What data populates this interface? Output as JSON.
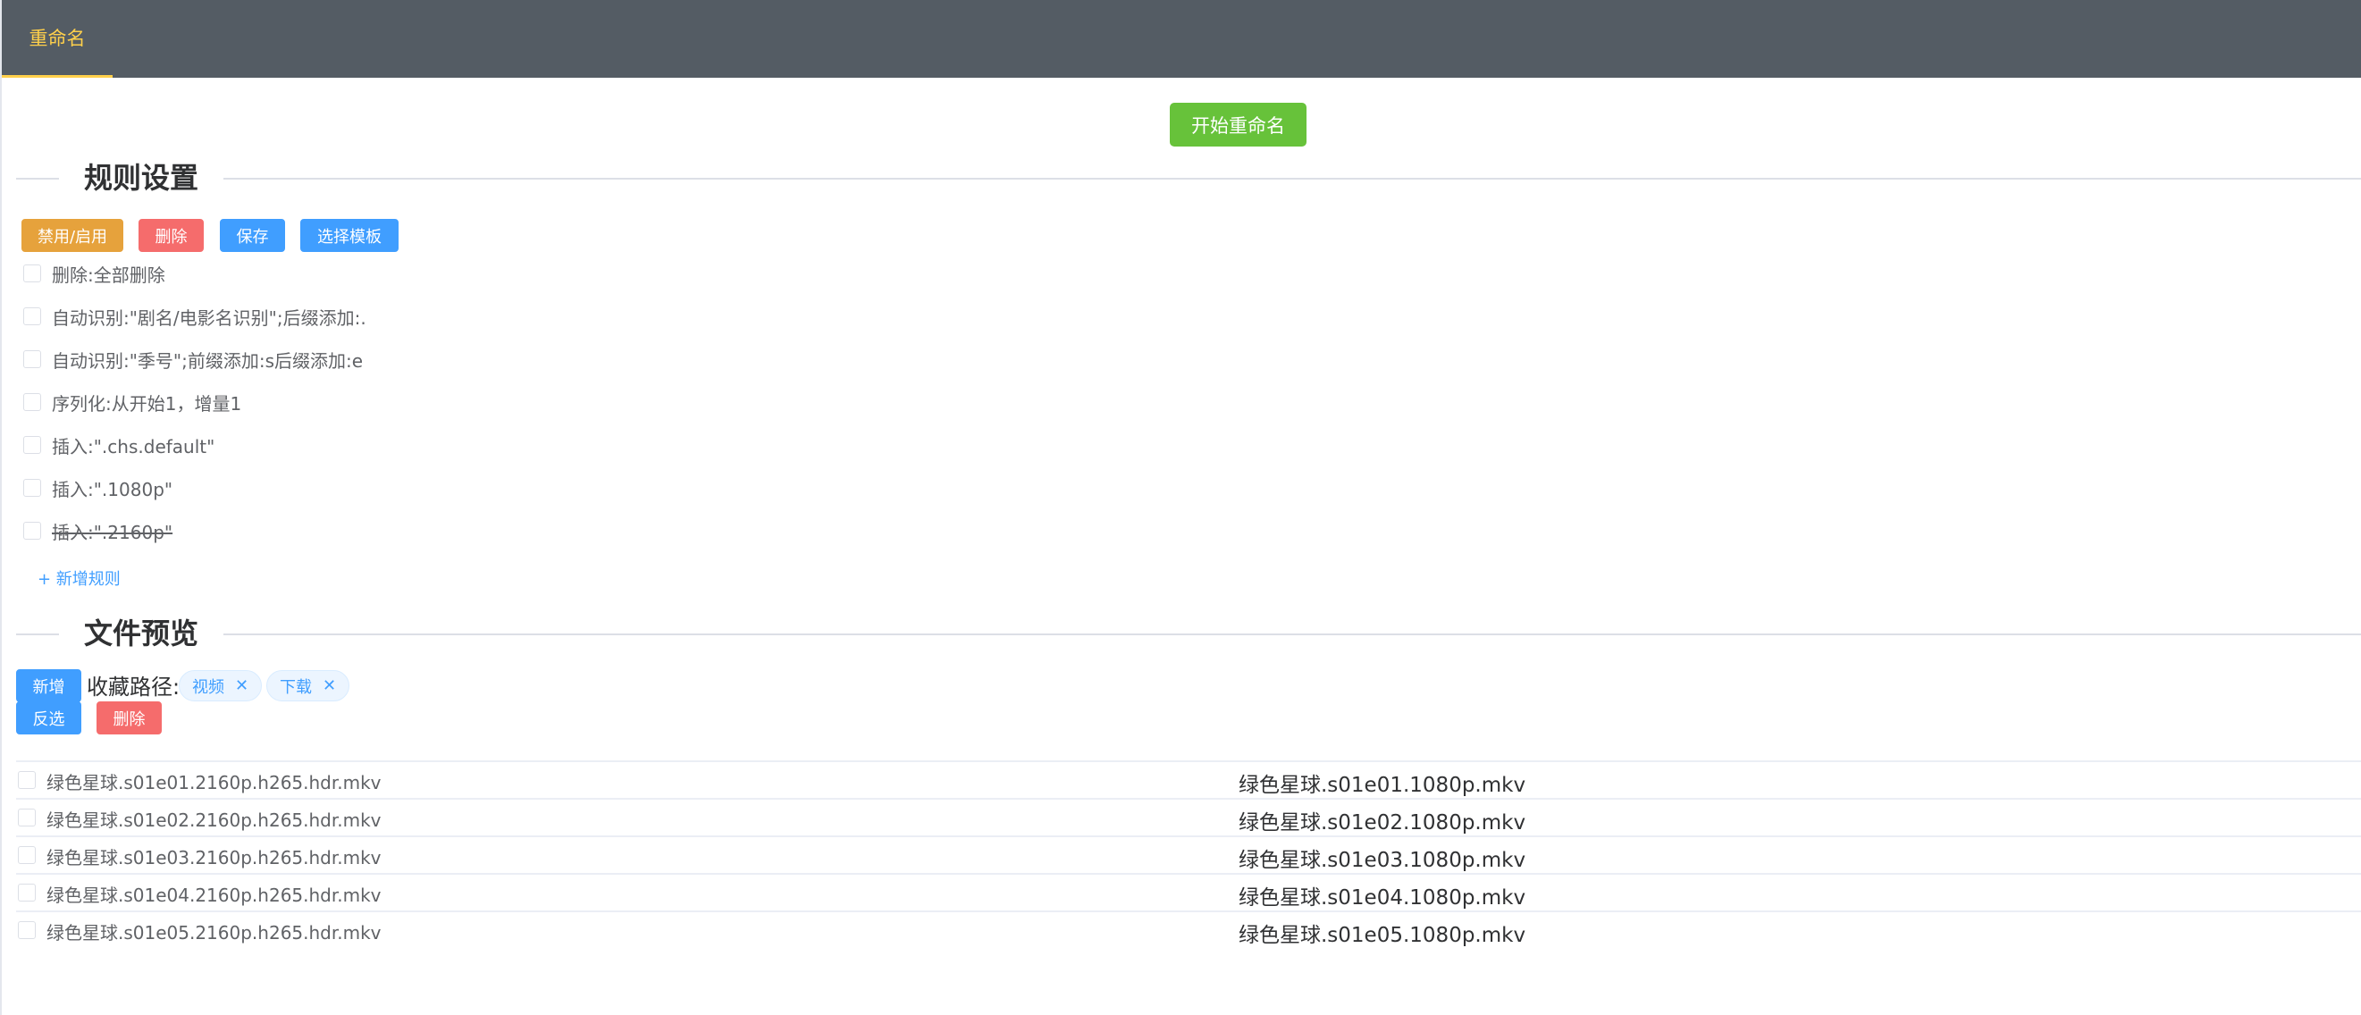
{
  "header": {
    "tab_label": "重命名",
    "accent_color": "#ffd04b",
    "background_color": "#545c64"
  },
  "toolbar": {
    "start_label": "开始重命名"
  },
  "rules_section": {
    "title": "规则设置",
    "buttons": {
      "toggle_label": "禁用/启用",
      "delete_label": "删除",
      "save_label": "保存",
      "template_label": "选择模板"
    },
    "rules": [
      {
        "text": "删除:全部删除",
        "disabled": false
      },
      {
        "text": "自动识别:\"剧名/电影名识别\";后缀添加:.",
        "disabled": false
      },
      {
        "text": "自动识别:\"季号\";前缀添加:s后缀添加:e",
        "disabled": false
      },
      {
        "text": "序列化:从开始1，增量1",
        "disabled": false
      },
      {
        "text": "插入:\".chs.default\"",
        "disabled": false
      },
      {
        "text": "插入:\".1080p\"",
        "disabled": false
      },
      {
        "text": "插入:\".2160p\"",
        "disabled": true
      }
    ],
    "add_rule_label": "+ 新增规则"
  },
  "files_section": {
    "title": "文件预览",
    "add_label": "新增",
    "favorites_label": "收藏路径:",
    "favorites": [
      "视频",
      "下载"
    ],
    "invert_label": "反选",
    "delete_label": "删除",
    "files": [
      {
        "old": "绿色星球.s01e01.2160p.h265.hdr.mkv",
        "new": "绿色星球.s01e01.1080p.mkv"
      },
      {
        "old": "绿色星球.s01e02.2160p.h265.hdr.mkv",
        "new": "绿色星球.s01e02.1080p.mkv"
      },
      {
        "old": "绿色星球.s01e03.2160p.h265.hdr.mkv",
        "new": "绿色星球.s01e03.1080p.mkv"
      },
      {
        "old": "绿色星球.s01e04.2160p.h265.hdr.mkv",
        "new": "绿色星球.s01e04.1080p.mkv"
      },
      {
        "old": "绿色星球.s01e05.2160p.h265.hdr.mkv",
        "new": "绿色星球.s01e05.1080p.mkv"
      }
    ]
  }
}
